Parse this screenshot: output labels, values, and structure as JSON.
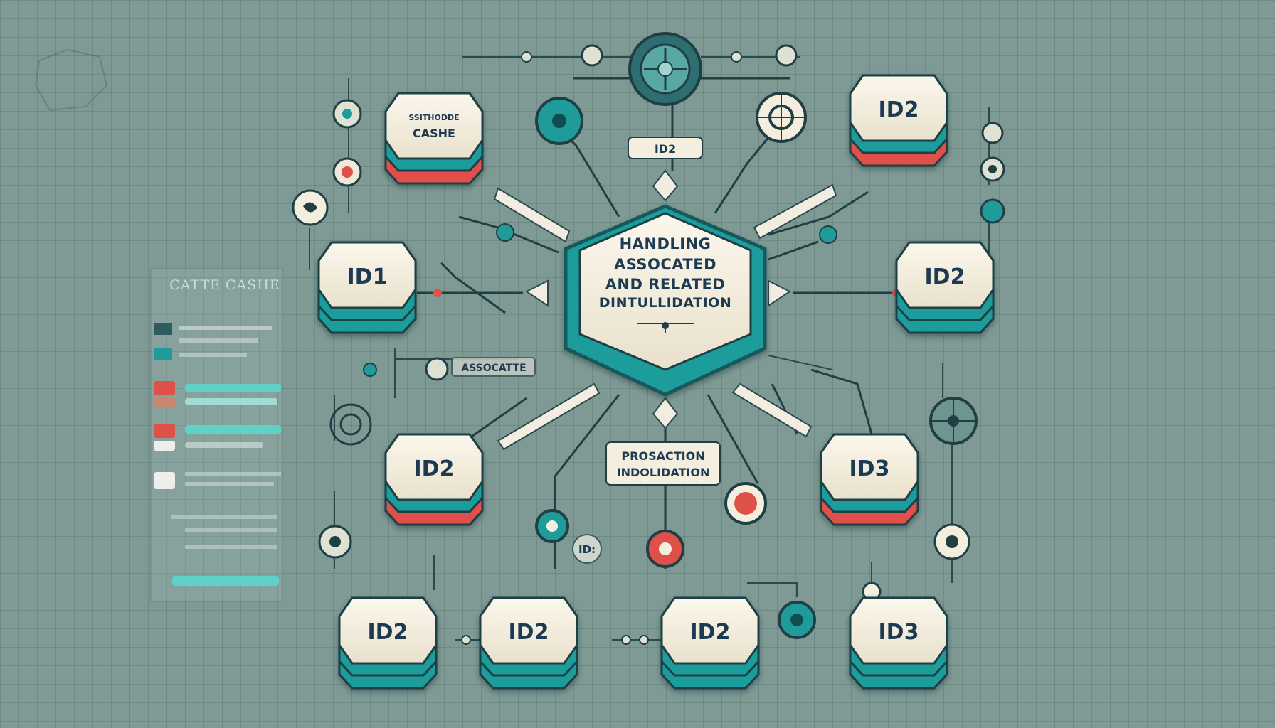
{
  "diagram": {
    "center": {
      "lines": [
        "HANDLING",
        "ASSOCATED",
        "AND RELATED",
        "DINTULLIDATION"
      ]
    },
    "nodes": [
      {
        "id": "cache-node",
        "lines": [
          "SSITHODDE",
          "CASHE"
        ],
        "base": "red"
      },
      {
        "id": "id2-top-right",
        "lines": [
          "ID2"
        ],
        "base": "red"
      },
      {
        "id": "id1-left",
        "lines": [
          "ID1"
        ],
        "base": "teal"
      },
      {
        "id": "id2-right",
        "lines": [
          "ID2"
        ],
        "base": "teal"
      },
      {
        "id": "id2-mid-left",
        "lines": [
          "ID2"
        ],
        "base": "red"
      },
      {
        "id": "id3-mid-right",
        "lines": [
          "ID3"
        ],
        "base": "red"
      },
      {
        "id": "id2-bottom-1",
        "lines": [
          "ID2"
        ],
        "base": "teal"
      },
      {
        "id": "id2-bottom-2",
        "lines": [
          "ID2"
        ],
        "base": "teal"
      },
      {
        "id": "id2-bottom-3",
        "lines": [
          "ID2"
        ],
        "base": "teal"
      },
      {
        "id": "id3-bottom",
        "lines": [
          "ID3"
        ],
        "base": "teal"
      }
    ],
    "tags": {
      "top": "ID2",
      "associate": "ASSOCATTE",
      "production": [
        "PROSACTION",
        "INDOLIDATION"
      ],
      "small_id": "ID:"
    },
    "side_panel": {
      "title": "CATTE CASHE"
    },
    "colors": {
      "background": "#7f9a94",
      "teal": "#1f9c9a",
      "red": "#e0504a",
      "cream": "#f4eedf",
      "dark": "#1d3b52"
    }
  }
}
